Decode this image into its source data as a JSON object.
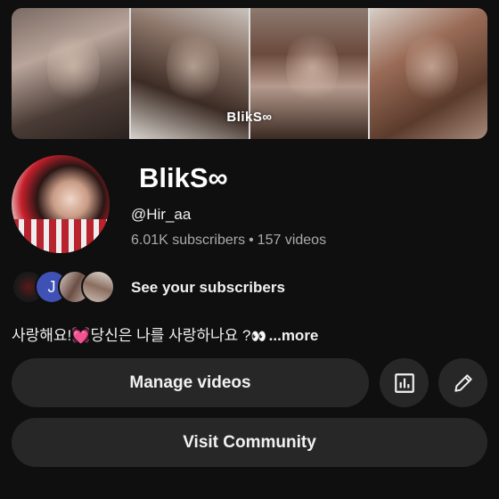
{
  "banner": {
    "logo_text": "BlikS∞"
  },
  "channel": {
    "name": "BlikS∞",
    "handle": "@Hir_aa",
    "subscribers": "6.01K subscribers",
    "separator": "•",
    "videos": "157 videos"
  },
  "subscribers_row": {
    "avatar_initial": "J",
    "label": "See your subscribers"
  },
  "description": {
    "text": "사랑해요!💓당신은 나를 사랑하나요 ?",
    "eyes": "👀",
    "more": " ...more"
  },
  "actions": {
    "manage_videos": "Manage videos",
    "visit_community": "Visit Community",
    "analytics_icon": "bar-chart-icon",
    "edit_icon": "pencil-icon"
  },
  "colors": {
    "background": "#0f0f0f",
    "button": "#272727",
    "secondary_text": "#aaaaaa",
    "avatar_j": "#3f51b5"
  }
}
